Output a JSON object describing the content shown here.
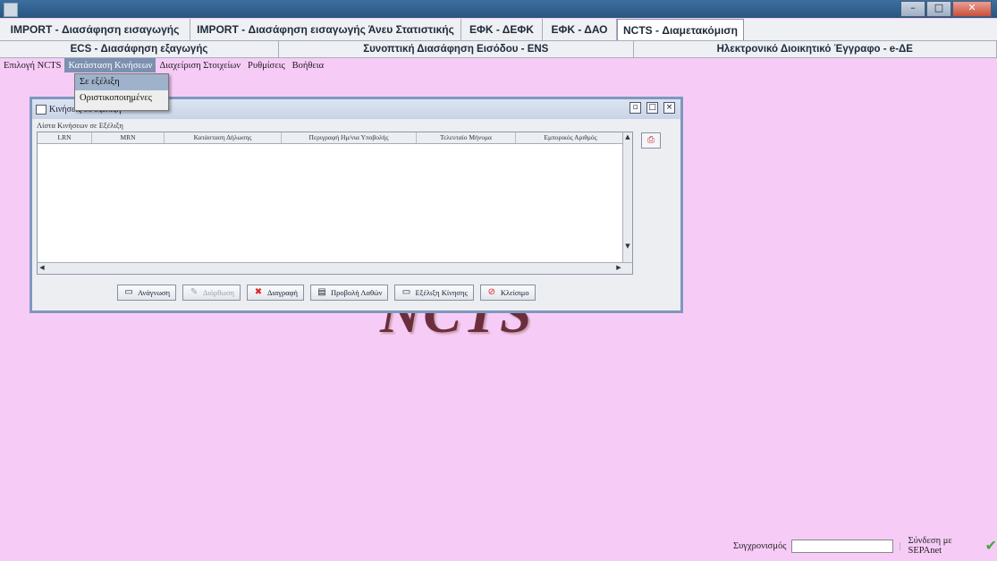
{
  "tabs_row1": [
    "IMPORT - Διασάφηση εισαγωγής",
    "IMPORT - Διασάφηση εισαγωγής Άνευ Στατιστικής",
    "ΕΦΚ - ΔΕΦΚ",
    "ΕΦΚ - ΔΑΟ",
    "NCTS - Διαμετακόμιση"
  ],
  "tabs_row2": [
    "ECS - Διασάφηση εξαγωγής",
    "Συνοπτική Διασάφηση Εισόδου - ENS",
    "Ηλεκτρονικό Διοικητικό Έγγραφο - e-ΔΕ"
  ],
  "menu": [
    "Επιλογή NCTS",
    "Κατάσταση Κινήσεων",
    "Διαχείριση Στοιχείων",
    "Ρυθμίσεις",
    "Βοήθεια"
  ],
  "dropdown": [
    "Σε εξέλιξη",
    "Οριστικοποιημένες"
  ],
  "internal_frame": {
    "title": "Κινήσεις σε εξέλιξη",
    "list_label": "Λίστα Κινήσεων σε Εξέλιξη",
    "columns": [
      "LRN",
      "MRN",
      "Κατάσταση Δήλωσης",
      "Περιγραφή Ημ/νια Υποβολής",
      "Τελευταίο Μήνυμα",
      "Εμπορικός Αριθμός"
    ]
  },
  "buttons": [
    "Ανάγνωση",
    "Διόρθωση",
    "Διαγραφή",
    "Προβολή Λαθών",
    "Εξέλιξη Κίνησης",
    "Κλείσιμο"
  ],
  "watermark": "NCTS",
  "status": {
    "sync_label": "Συγχρονισμός",
    "sepa_label": "Σύνδεση με SEPAnet"
  }
}
